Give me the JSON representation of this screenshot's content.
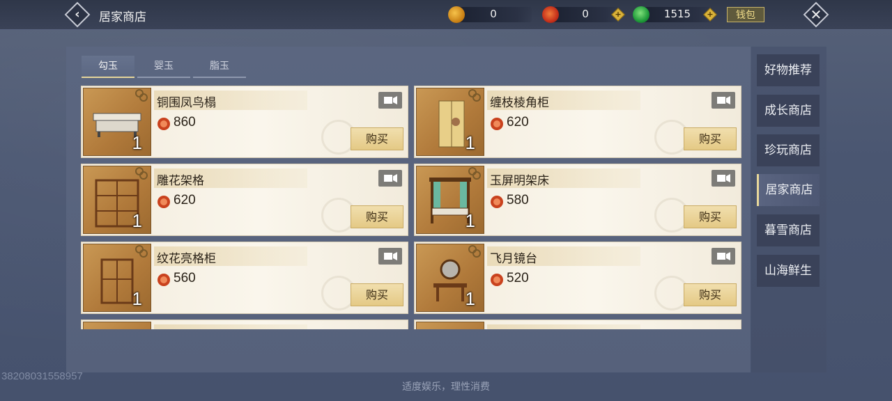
{
  "header": {
    "title": "居家商店",
    "currencies": [
      {
        "icon": "gold-pouch-icon",
        "value": "0"
      },
      {
        "icon": "red-coin-icon",
        "value": "0"
      },
      {
        "icon": "jade-icon",
        "value": "1515"
      }
    ],
    "wallet_label": "钱包"
  },
  "tabs": [
    {
      "label": "勾玉",
      "active": true
    },
    {
      "label": "婴玉",
      "active": false
    },
    {
      "label": "脂玉",
      "active": false
    }
  ],
  "items": [
    {
      "name": "铜围凤鸟榻",
      "price": "860",
      "qty": "1",
      "buy": "购买"
    },
    {
      "name": "缠枝棱角柜",
      "price": "620",
      "qty": "1",
      "buy": "购买"
    },
    {
      "name": "雕花架格",
      "price": "620",
      "qty": "1",
      "buy": "购买"
    },
    {
      "name": "玉屏明架床",
      "price": "580",
      "qty": "1",
      "buy": "购买"
    },
    {
      "name": "纹花亮格柜",
      "price": "560",
      "qty": "1",
      "buy": "购买"
    },
    {
      "name": "飞月镜台",
      "price": "520",
      "qty": "1",
      "buy": "购买"
    }
  ],
  "side_nav": [
    {
      "label": "好物推荐",
      "active": false
    },
    {
      "label": "成长商店",
      "active": false
    },
    {
      "label": "珍玩商店",
      "active": false
    },
    {
      "label": "居家商店",
      "active": true
    },
    {
      "label": "暮雪商店",
      "active": false
    },
    {
      "label": "山海鲜生",
      "active": false
    }
  ],
  "user_id": "38208031558957",
  "footer_note": "适度娱乐，理性消费",
  "colors": {
    "background": "#4b5773",
    "card": "#f8f3e8",
    "buy_button": "#ebd496",
    "accent_gold": "#e6d69a"
  }
}
